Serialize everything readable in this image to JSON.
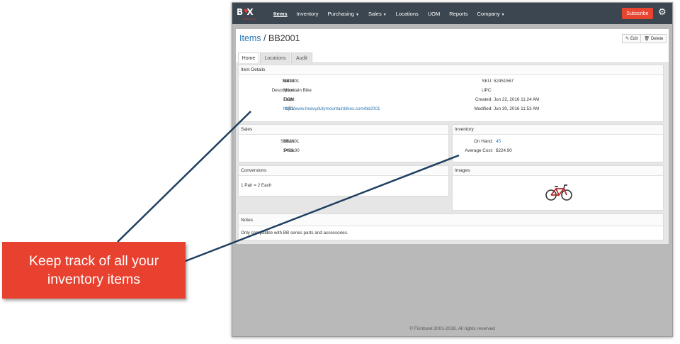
{
  "navbar": {
    "logo_text": "B X",
    "logo_sub": "ERATH",
    "items": [
      {
        "label": "Items",
        "active": true,
        "dropdown": false
      },
      {
        "label": "Inventory",
        "active": false,
        "dropdown": false
      },
      {
        "label": "Purchasing",
        "active": false,
        "dropdown": true
      },
      {
        "label": "Sales",
        "active": false,
        "dropdown": true
      },
      {
        "label": "Locations",
        "active": false,
        "dropdown": false
      },
      {
        "label": "UOM",
        "active": false,
        "dropdown": false
      },
      {
        "label": "Reports",
        "active": false,
        "dropdown": false
      },
      {
        "label": "Company",
        "active": false,
        "dropdown": true
      }
    ],
    "subscribe_label": "Subscribe"
  },
  "header": {
    "breadcrumb_link": "Items",
    "separator": " / ",
    "title": "BB2001",
    "edit_label": "Edit",
    "delete_label": "Delete"
  },
  "tabs": [
    {
      "label": "Home"
    },
    {
      "label": "Locations"
    },
    {
      "label": "Audit"
    }
  ],
  "item_details": {
    "heading": "Item Details",
    "name_label": "Name:",
    "name": "BB2001",
    "description_label": "Description:",
    "description": "Mountain Bike",
    "uom_label": "UOM:",
    "uom": "Each",
    "url_label": "URL:",
    "url": "http://www.heavydutymountainbikes.com/bb2001",
    "sku_label": "SKU:",
    "sku": "52451567",
    "upc_label": "UPC:",
    "upc": "",
    "created_label": "Created:",
    "created": "Jun 22, 2016 11:24 AM",
    "modified_label": "Modified:",
    "modified": "Jun 30, 2016 11:53 AM"
  },
  "sales": {
    "heading": "Sales",
    "sell_as_label": "Sell As:",
    "sell_as": "BB2001",
    "price_label": "Price:",
    "price": "$499.00"
  },
  "inventory": {
    "heading": "Inventory",
    "on_hand_label": "On Hand:",
    "on_hand": "45",
    "avg_cost_label": "Average Cost:",
    "avg_cost": "$224.90"
  },
  "conversions": {
    "heading": "Conversions",
    "text": "1 Pair = 2 Each"
  },
  "images": {
    "heading": "Images"
  },
  "notes": {
    "heading": "Notes",
    "text": "Only compatible with BB series parts and accessories."
  },
  "footer": "© Fishbowl 2001-2016. All rights reserved",
  "callout": {
    "line1": "Keep track of all your",
    "line2": "inventory items"
  },
  "colors": {
    "navbar": "#3b4650",
    "accent_red": "#e84530",
    "link_blue": "#2a7ab8",
    "annotation_line": "#1f3f60"
  }
}
